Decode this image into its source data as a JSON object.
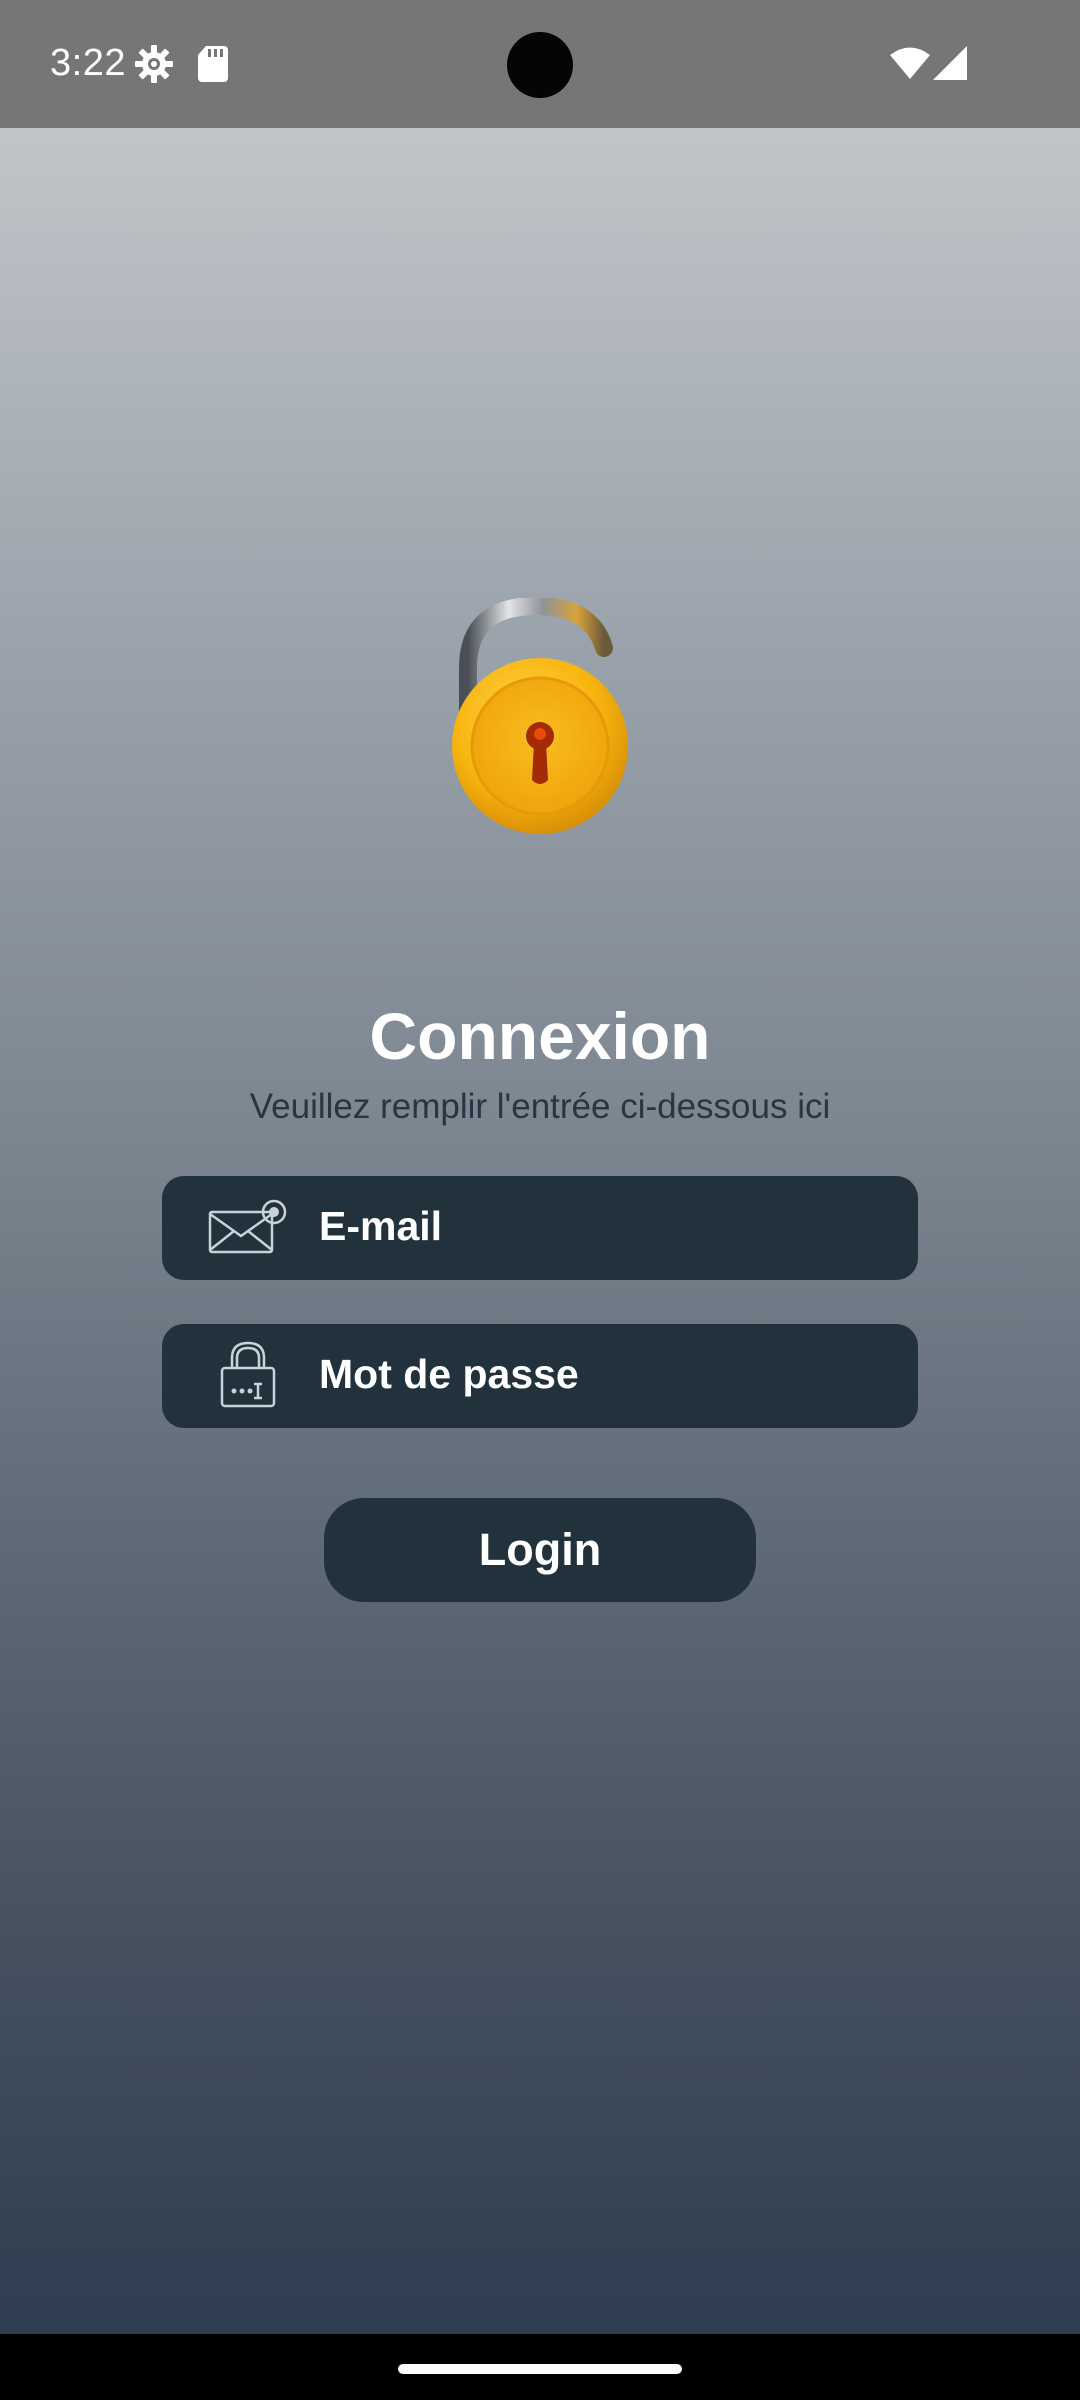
{
  "status_bar": {
    "time": "3:22",
    "icons": [
      "settings-gear-icon",
      "sd-card-icon",
      "wifi-icon",
      "cellular-signal-icon"
    ]
  },
  "login": {
    "hero_icon": "unlocked-padlock-icon",
    "title": "Connexion",
    "subtitle": "Veuillez remplir l'entrée ci-dessous ici",
    "email_label": "E-mail",
    "email_icon": "envelope-icon",
    "password_label": "Mot de passe",
    "password_icon": "lock-password-icon",
    "login_button": "Login"
  },
  "colors": {
    "field_background": "#22323d",
    "title_text": "#ffffff",
    "subtitle_text": "#2b3440",
    "lock_gold": "#f6b611"
  }
}
